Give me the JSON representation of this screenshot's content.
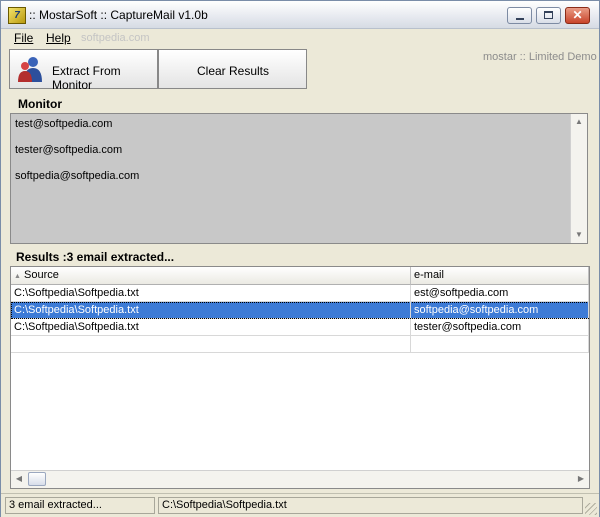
{
  "window": {
    "title": ":: MostarSoft :: CaptureMail v1.0b",
    "icon": "app-logo-icon"
  },
  "titlebar_buttons": [
    "minimize",
    "maximize",
    "close"
  ],
  "menu": [
    {
      "label": "File"
    },
    {
      "label": "Help"
    }
  ],
  "watermark": "softpedia.com",
  "toolbar": {
    "extract_label": "Extract From Monitor",
    "clear_label": "Clear Results",
    "demo_text": "mostar :: Limited Demo"
  },
  "monitor": {
    "label": "Monitor",
    "lines": [
      "test@softpedia.com",
      "tester@softpedia.com",
      "softpedia@softpedia.com"
    ]
  },
  "results": {
    "label": "Results :3 email extracted...",
    "columns": [
      "Source",
      "e-mail"
    ],
    "rows": [
      {
        "source": "C:\\Softpedia\\Softpedia.txt",
        "email": "est@softpedia.com",
        "selected": false
      },
      {
        "source": "C:\\Softpedia\\Softpedia.txt",
        "email": "softpedia@softpedia.com",
        "selected": true
      },
      {
        "source": "C:\\Softpedia\\Softpedia.txt",
        "email": "tester@softpedia.com",
        "selected": false
      }
    ]
  },
  "status": {
    "left": "3 email extracted...",
    "right": "C:\\Softpedia\\Softpedia.txt"
  },
  "colors": {
    "selection": "#3d7bd6",
    "monitor_bg": "#c8c8c8",
    "window_bg": "#ece9d8"
  }
}
